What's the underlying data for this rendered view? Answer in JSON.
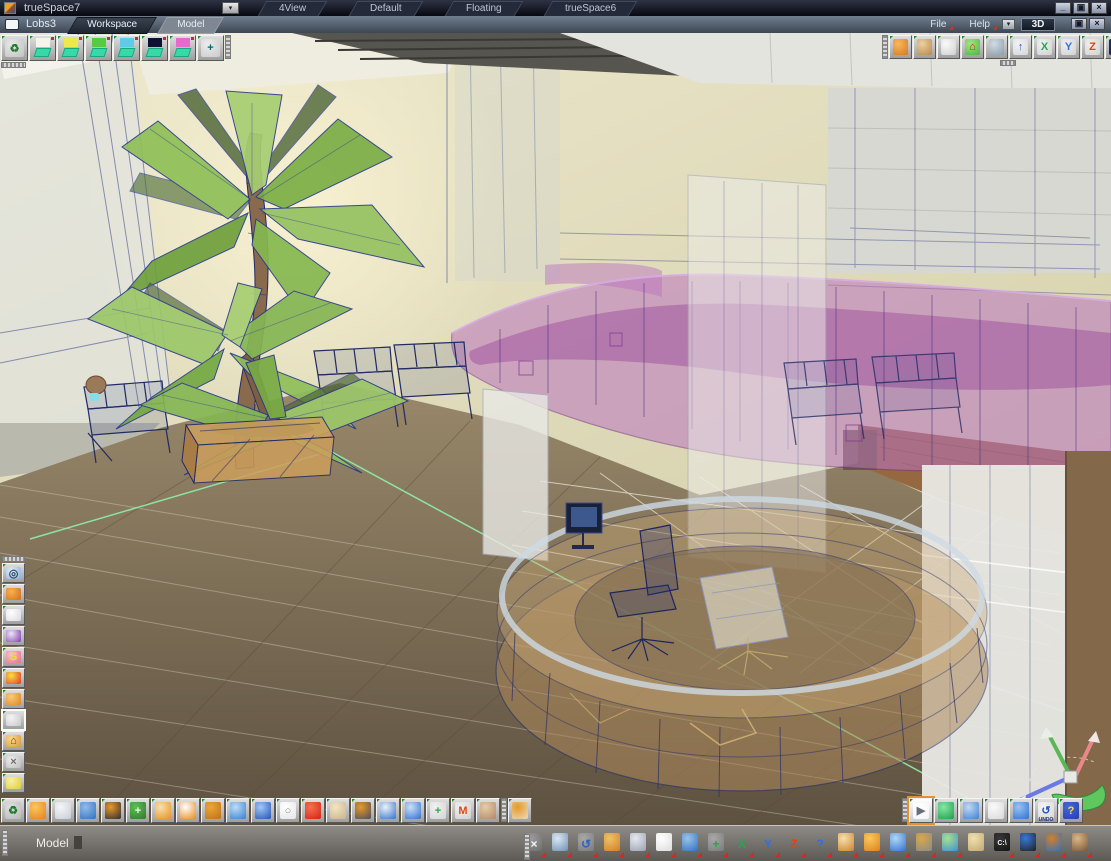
{
  "title_bar": {
    "app_title": "trueSpace7",
    "dropdown_glyph": "▾",
    "tabs": [
      "4View",
      "Default",
      "Floating",
      "trueSpace6"
    ],
    "window_buttons": {
      "minimize": "_",
      "restore": "▣",
      "close": "×"
    }
  },
  "config_bar": {
    "doc_tab": "Lobs3",
    "tabs": [
      {
        "label": "Workspace",
        "active": true
      },
      {
        "label": "Model",
        "active": false
      }
    ],
    "menus": [
      "File",
      "Help"
    ],
    "dropdown_glyph": "▾",
    "view_button": "3D",
    "window_buttons": {
      "restore": "▣",
      "close": "×"
    }
  },
  "status_bar": {
    "prompt": "Model"
  },
  "toolbars": {
    "scene_palette": {
      "items": [
        {
          "name": "delete-scene-icon",
          "glyph": "♻",
          "fg": "#1e7a2e",
          "c1": "#c2c2c2",
          "c2": "#e8e8e8"
        },
        {
          "name": "scene-slot-white",
          "kind": "scene-slot",
          "c1": "#f4f4ec"
        },
        {
          "name": "scene-slot-yellow",
          "kind": "scene-slot",
          "c1": "#ece84e"
        },
        {
          "name": "scene-slot-green",
          "kind": "scene-slot",
          "c1": "#54cc40"
        },
        {
          "name": "scene-slot-cyan",
          "kind": "scene-slot",
          "c1": "#5ecce8"
        },
        {
          "name": "scene-slot-navy",
          "kind": "scene-slot",
          "c1": "#0e1232"
        },
        {
          "name": "scene-slot-magenta",
          "kind": "scene-slot",
          "c1": "#e868cc"
        },
        {
          "name": "add-scene-icon",
          "glyph": "+",
          "fg": "#006a6a",
          "c1": "#cacaca",
          "c2": "#ececec"
        }
      ]
    },
    "view_controls": {
      "items": [
        {
          "name": "object-mode-icon",
          "c1": "#d87818",
          "c2": "#f8b860"
        },
        {
          "name": "wireframe-cube-icon",
          "c1": "#b88848",
          "c2": "#ecd0a0"
        },
        {
          "name": "border-select-icon",
          "c1": "#cfcfcf",
          "c2": "#fafafa"
        },
        {
          "name": "home-view-icon",
          "glyph": "⌂",
          "fg": "#c22818",
          "c1": "#50b43c",
          "c2": "#9ce884"
        },
        {
          "name": "render-view-icon",
          "c1": "#8c9cac",
          "c2": "#d0dce4"
        },
        {
          "name": "walk-view-icon",
          "glyph": "↑",
          "fg": "#2a56c8",
          "c1": "#d6d6d6",
          "c2": "#f2f2f2"
        },
        {
          "name": "axis-x-icon",
          "glyph": "X",
          "fg": "#28a452",
          "c1": "#d2d2d2",
          "c2": "#f0f0f0"
        },
        {
          "name": "axis-y-icon",
          "glyph": "Y",
          "fg": "#3070e0",
          "c1": "#d2d2d2",
          "c2": "#f0f0f0"
        },
        {
          "name": "axis-z-icon",
          "glyph": "Z",
          "fg": "#dc4414",
          "c1": "#d2d2d2",
          "c2": "#f0f0f0"
        },
        {
          "name": "pan-view-icon",
          "glyph": "+",
          "fg": "#7cd83c",
          "c1": "#121a4a",
          "c2": "#283068"
        }
      ]
    },
    "left_tools": {
      "items": [
        {
          "name": "zoom-scene-icon",
          "glyph": "◎",
          "fg": "#304868",
          "c1": "#8cb0d4",
          "c2": "#e0ecf8"
        },
        {
          "name": "point-edit-icon",
          "c1": "#d07018",
          "c2": "#f8b050"
        },
        {
          "name": "primitives-icon",
          "c1": "#d8d8e0",
          "c2": "#ffffff"
        },
        {
          "name": "deform-icon",
          "c1": "#8838b8",
          "c2": "#e8e8f0"
        },
        {
          "name": "script-icon",
          "glyph": "S",
          "fg": "#f0e020",
          "c1": "#e87088",
          "c2": "#f8c0d0"
        },
        {
          "name": "material-rainbow-icon",
          "c1": "#e03828",
          "c2": "#f8e040"
        },
        {
          "name": "unwrap-box-icon",
          "c1": "#e08424",
          "c2": "#f8cc78"
        },
        {
          "name": "model-library-icon",
          "selected": true,
          "c1": "#c8c8c8",
          "c2": "#f4f4f4"
        },
        {
          "name": "scene-home-icon",
          "glyph": "⌂",
          "fg": "#6a3c0c",
          "c1": "#d89838",
          "c2": "#f8d890"
        },
        {
          "name": "utilities-icon",
          "glyph": "×",
          "fg": "#707070",
          "c1": "#bcbcbc",
          "c2": "#ececec"
        },
        {
          "name": "annotate-icon",
          "c1": "#e0cc40",
          "c2": "#f8f0a0"
        }
      ]
    },
    "bottom_left_tools": {
      "items": [
        {
          "name": "delete-material-icon",
          "glyph": "♻",
          "fg": "#1e7a2e",
          "c1": "#b8b8b8",
          "c2": "#e0e0e0"
        },
        {
          "name": "material-sphere-icon",
          "c1": "#e88018",
          "c2": "#f8c860"
        },
        {
          "name": "pick-material-icon",
          "c1": "#c8ccd4",
          "c2": "#f4f6f8"
        },
        {
          "name": "airbrush-icon",
          "c1": "#3070c0",
          "c2": "#90bce8"
        },
        {
          "name": "paint-face-icon",
          "c1": "#2c2c34",
          "c2": "#e89828"
        },
        {
          "name": "add-material-icon",
          "glyph": "+",
          "fg": "#e8f8e8",
          "c1": "#307830",
          "c2": "#60c050"
        },
        {
          "name": "paint-object-icon",
          "c1": "#e89020",
          "c2": "#f8e0b0"
        },
        {
          "name": "erase-material-icon",
          "c1": "#e88818",
          "c2": "#ffffff"
        },
        {
          "name": "rough-shader-icon",
          "c1": "#c07018",
          "c2": "#e8a838"
        },
        {
          "name": "uv-editor-icon",
          "c1": "#3080d0",
          "c2": "#c0dcf8"
        },
        {
          "name": "draw-pencil-icon",
          "c1": "#2454b0",
          "c2": "#a0c8f8"
        },
        {
          "name": "lasso-icon",
          "glyph": "○",
          "fg": "#8a8a8a",
          "c1": "#e4e4e4",
          "c2": "#ffffff"
        },
        {
          "name": "bend-surface-icon",
          "c1": "#d02414",
          "c2": "#f87050"
        },
        {
          "name": "palette-icon",
          "c1": "#c8b48c",
          "c2": "#f4e4c4"
        },
        {
          "name": "bake-texture-icon",
          "c1": "#4c4c5c",
          "c2": "#e89828"
        },
        {
          "name": "checker-flag-icon",
          "c1": "#3070d0",
          "c2": "#ecf2f8"
        },
        {
          "name": "environment-sphere-icon",
          "c1": "#3070d0",
          "c2": "#cce0f8"
        },
        {
          "name": "object-axes-icon",
          "glyph": "+",
          "fg": "#28a848",
          "c1": "#d4d4d4",
          "c2": "#f0f0f0"
        },
        {
          "name": "material-view-icon",
          "glyph": "M",
          "fg": "#e04818",
          "c1": "#d0d0d0",
          "c2": "#f0f0f0"
        },
        {
          "name": "actor-head-icon",
          "c1": "#b08868",
          "c2": "#e8cca8"
        }
      ]
    },
    "bottom_left_tail": {
      "items": [
        {
          "name": "plugin-icon",
          "c1": "#e8dcc0",
          "c2": "#e89828"
        }
      ]
    },
    "bottom_right_tools": {
      "items": [
        {
          "name": "select-tool-icon",
          "glyph": "▶",
          "fg": "#686f7c",
          "c1": "#f4f4f4",
          "c2": "#ffffff",
          "sel": "orange"
        },
        {
          "name": "open-cube-icon",
          "c1": "#1e9c4c",
          "c2": "#84e8a4"
        },
        {
          "name": "grid-plane-icon",
          "c1": "#4080d0",
          "c2": "#c0d8f4"
        },
        {
          "name": "plane-in-box-icon",
          "c1": "#d8d8d8",
          "c2": "#fafafa"
        },
        {
          "name": "point-move-icon",
          "c1": "#3070d0",
          "c2": "#98c4f4"
        },
        {
          "name": "undo-icon",
          "glyph": "↺",
          "fg": "#2050c0",
          "sub": "UNDO",
          "c1": "#d6d6d6",
          "c2": "#f4f4f4"
        },
        {
          "name": "help-icon",
          "glyph": "?",
          "fg": "#f8e020",
          "c1": "#2040b0",
          "c2": "#4868d8"
        }
      ]
    },
    "status_tools_a": {
      "items": [
        {
          "name": "object-tool-icon",
          "glyph": "×",
          "fg": "#f4f4f4",
          "c1": "#6e6e6e",
          "c2": "#9a9a9a",
          "flyout": true
        },
        {
          "name": "widget-tool-icon",
          "c1": "#7090b0",
          "c2": "#d8e8f4",
          "flyout": true
        },
        {
          "name": "sweep-tool-icon",
          "glyph": "↺",
          "fg": "#3060c0",
          "c1": "#7a7a7a",
          "c2": "#a8a8a8",
          "flyout": true
        },
        {
          "name": "object-box-tool-icon",
          "c1": "#d08028",
          "c2": "#f0c068",
          "flyout": true
        },
        {
          "name": "save-icon",
          "c1": "#9aa0b0",
          "c2": "#e4e8f0",
          "flyout": true
        },
        {
          "name": "cube-tool-icon",
          "c1": "#dcdcdc",
          "c2": "#ffffff",
          "flyout": true
        },
        {
          "name": "spray-tool-icon",
          "c1": "#3070c0",
          "c2": "#98c4e8",
          "flyout": true
        },
        {
          "name": "axes-tool-icon",
          "glyph": "+",
          "fg": "#30a048",
          "c1": "#7a7a7a",
          "c2": "#a8a8a8",
          "flyout": true
        },
        {
          "name": "x-constraint-icon",
          "glyph": "X",
          "fg": "#28a452",
          "flyout": true
        },
        {
          "name": "y-constraint-icon",
          "glyph": "Y",
          "fg": "#3070e0",
          "flyout": true
        },
        {
          "name": "z-constraint-icon",
          "glyph": "Z",
          "fg": "#dc4414",
          "flyout": true
        },
        {
          "name": "query-tool-icon",
          "glyph": "?",
          "fg": "#3070e0",
          "flyout": true
        },
        {
          "name": "grab-tool-icon",
          "c1": "#d08028",
          "c2": "#f4e0b0",
          "flyout": true
        },
        {
          "name": "sphere-tool-icon",
          "c1": "#e08018",
          "c2": "#f8c860",
          "flyout": true
        },
        {
          "name": "cone-tool-icon",
          "c1": "#3070d0",
          "c2": "#b0d8f4",
          "flyout": true
        },
        {
          "name": "grid-axis-icon",
          "c1": "#8a8a8a",
          "c2": "#d8a848",
          "flyout": true
        },
        {
          "name": "render-image-icon",
          "c1": "#4090d0",
          "c2": "#a8e090",
          "flyout": true
        }
      ]
    },
    "status_tools_b": {
      "items": [
        {
          "name": "library-panel-icon",
          "c1": "#c0a870",
          "c2": "#f0e0b0"
        },
        {
          "name": "console-icon",
          "glyph": "C:\\",
          "gs": 7,
          "fg": "#f4f4f4",
          "c1": "#141414",
          "c2": "#383838",
          "flyout": true
        },
        {
          "name": "link-editor-icon",
          "c1": "#202020",
          "c2": "#3878d8",
          "flyout": true
        },
        {
          "name": "collaborate-icon",
          "c1": "#3070c0",
          "c2": "#d08028",
          "flyout": true
        },
        {
          "name": "render-frame-icon",
          "c1": "#7c5434",
          "c2": "#d8b888",
          "flyout": true
        }
      ]
    }
  },
  "viewport": {
    "axis_widget_colors": {
      "x": "#e88888",
      "y": "#58b858",
      "z": "#6a78e8"
    },
    "colors": {
      "mezzanine_purple": "#bc76c0",
      "desk_tan": "#c19a66",
      "floor_brown": "#7a6a4e",
      "leaf_green": "#8fbf58",
      "wireframe_navy": "#2b3680"
    }
  }
}
